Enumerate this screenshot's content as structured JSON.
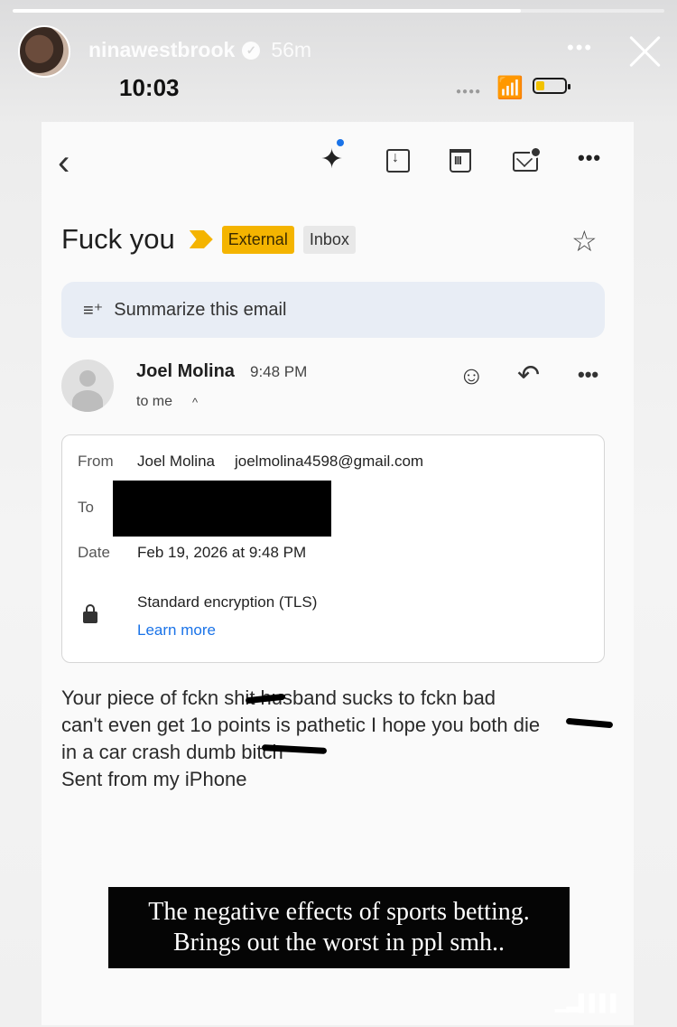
{
  "story": {
    "username": "ninawestbrook",
    "age": "56m",
    "progress": 0.78,
    "more_icon": "more-horizontal-icon",
    "close_icon": "close-icon"
  },
  "status_bar": {
    "time": "10:03",
    "battery_level": 0.3,
    "battery_color": "#f2c200"
  },
  "email": {
    "subject": "Fuck you",
    "labels": [
      "External",
      "Inbox"
    ],
    "label_colors": {
      "External": "#f4b400",
      "Inbox": "#e8e8e8"
    },
    "summarize_label": "Summarize this email",
    "sender_name": "Joel Molina",
    "sender_time": "9:48 PM",
    "recipient_summary": "to me",
    "details": {
      "from_label": "From",
      "from_name": "Joel Molina",
      "from_email": "joelmolina4598@gmail.com",
      "to_label": "To",
      "date_label": "Date",
      "date_value": "Feb 19, 2026 at 9:48 PM",
      "encryption": "Standard encryption (TLS)",
      "learn_more": "Learn more"
    },
    "body_lines": [
      "Your piece of fckn shit husband sucks to fckn bad",
      "can't even get 1o points is pathetic I hope you both die",
      "in a car crash dumb bitch",
      "Sent from my iPhone"
    ]
  },
  "caption": {
    "lines": [
      "The negative effects of sports betting.",
      "Brings out the worst in ppl smh.."
    ]
  },
  "colors": {
    "accent_blue": "#1a73e8",
    "summarize_bg": "#e8edf5"
  }
}
